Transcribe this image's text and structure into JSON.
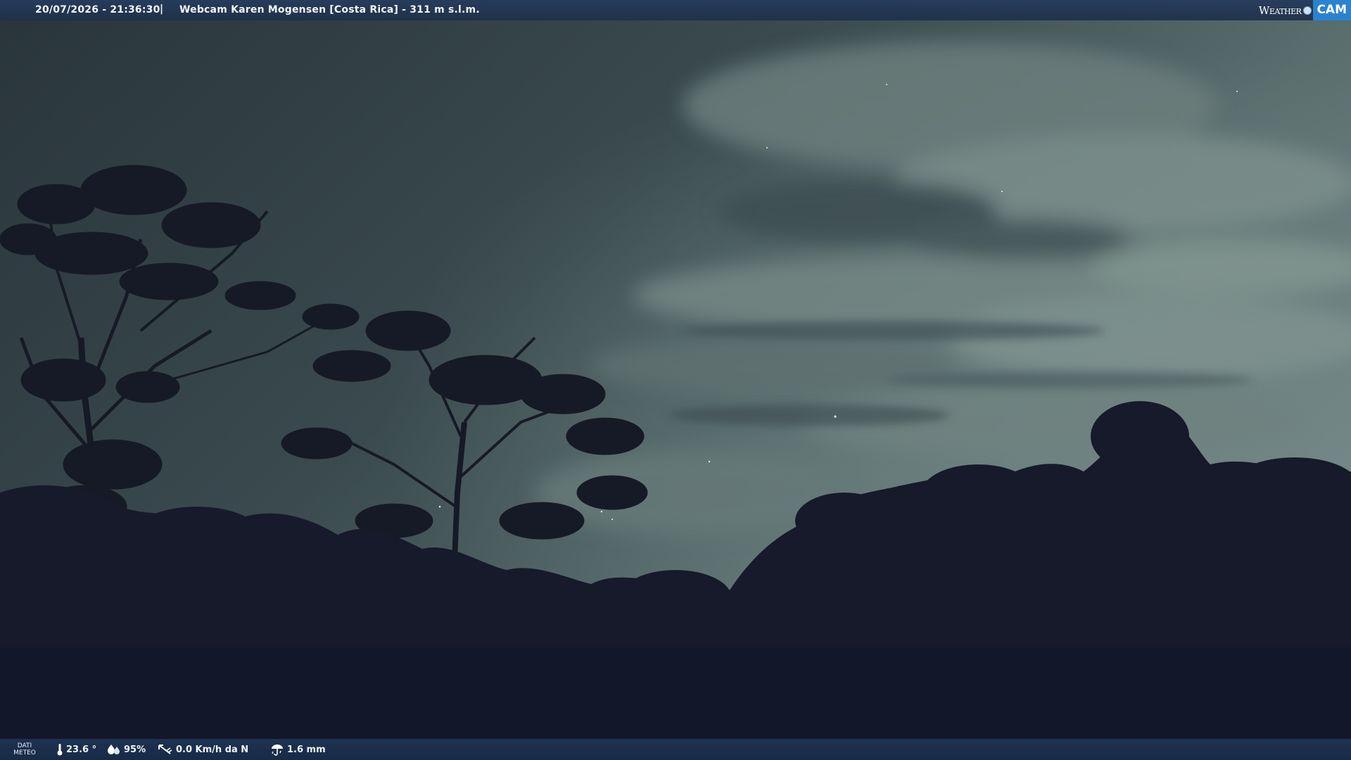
{
  "header": {
    "datetime": "20/07/2026 - 21:36:30",
    "separator": "|",
    "title": "Webcam Karen Mogensen [Costa Rica]  - 311 m s.l.m."
  },
  "logo": {
    "word": "Weather",
    "badge": "CAM"
  },
  "footer": {
    "dati_line1": "DATI",
    "dati_line2": "METEO",
    "temperature": "23.6 °",
    "humidity": "95%",
    "wind": "0.0 Km/h da N",
    "rain": "1.6 mm"
  },
  "colors": {
    "bar": "#263c5c",
    "badge": "#2b82cf",
    "sky_dark": "#2e3a40",
    "sky_light": "#6d8080",
    "silhouette": "#161a2a"
  },
  "icons": [
    "thermometer-icon",
    "humidity-icon",
    "wind-icon",
    "rain-icon"
  ]
}
